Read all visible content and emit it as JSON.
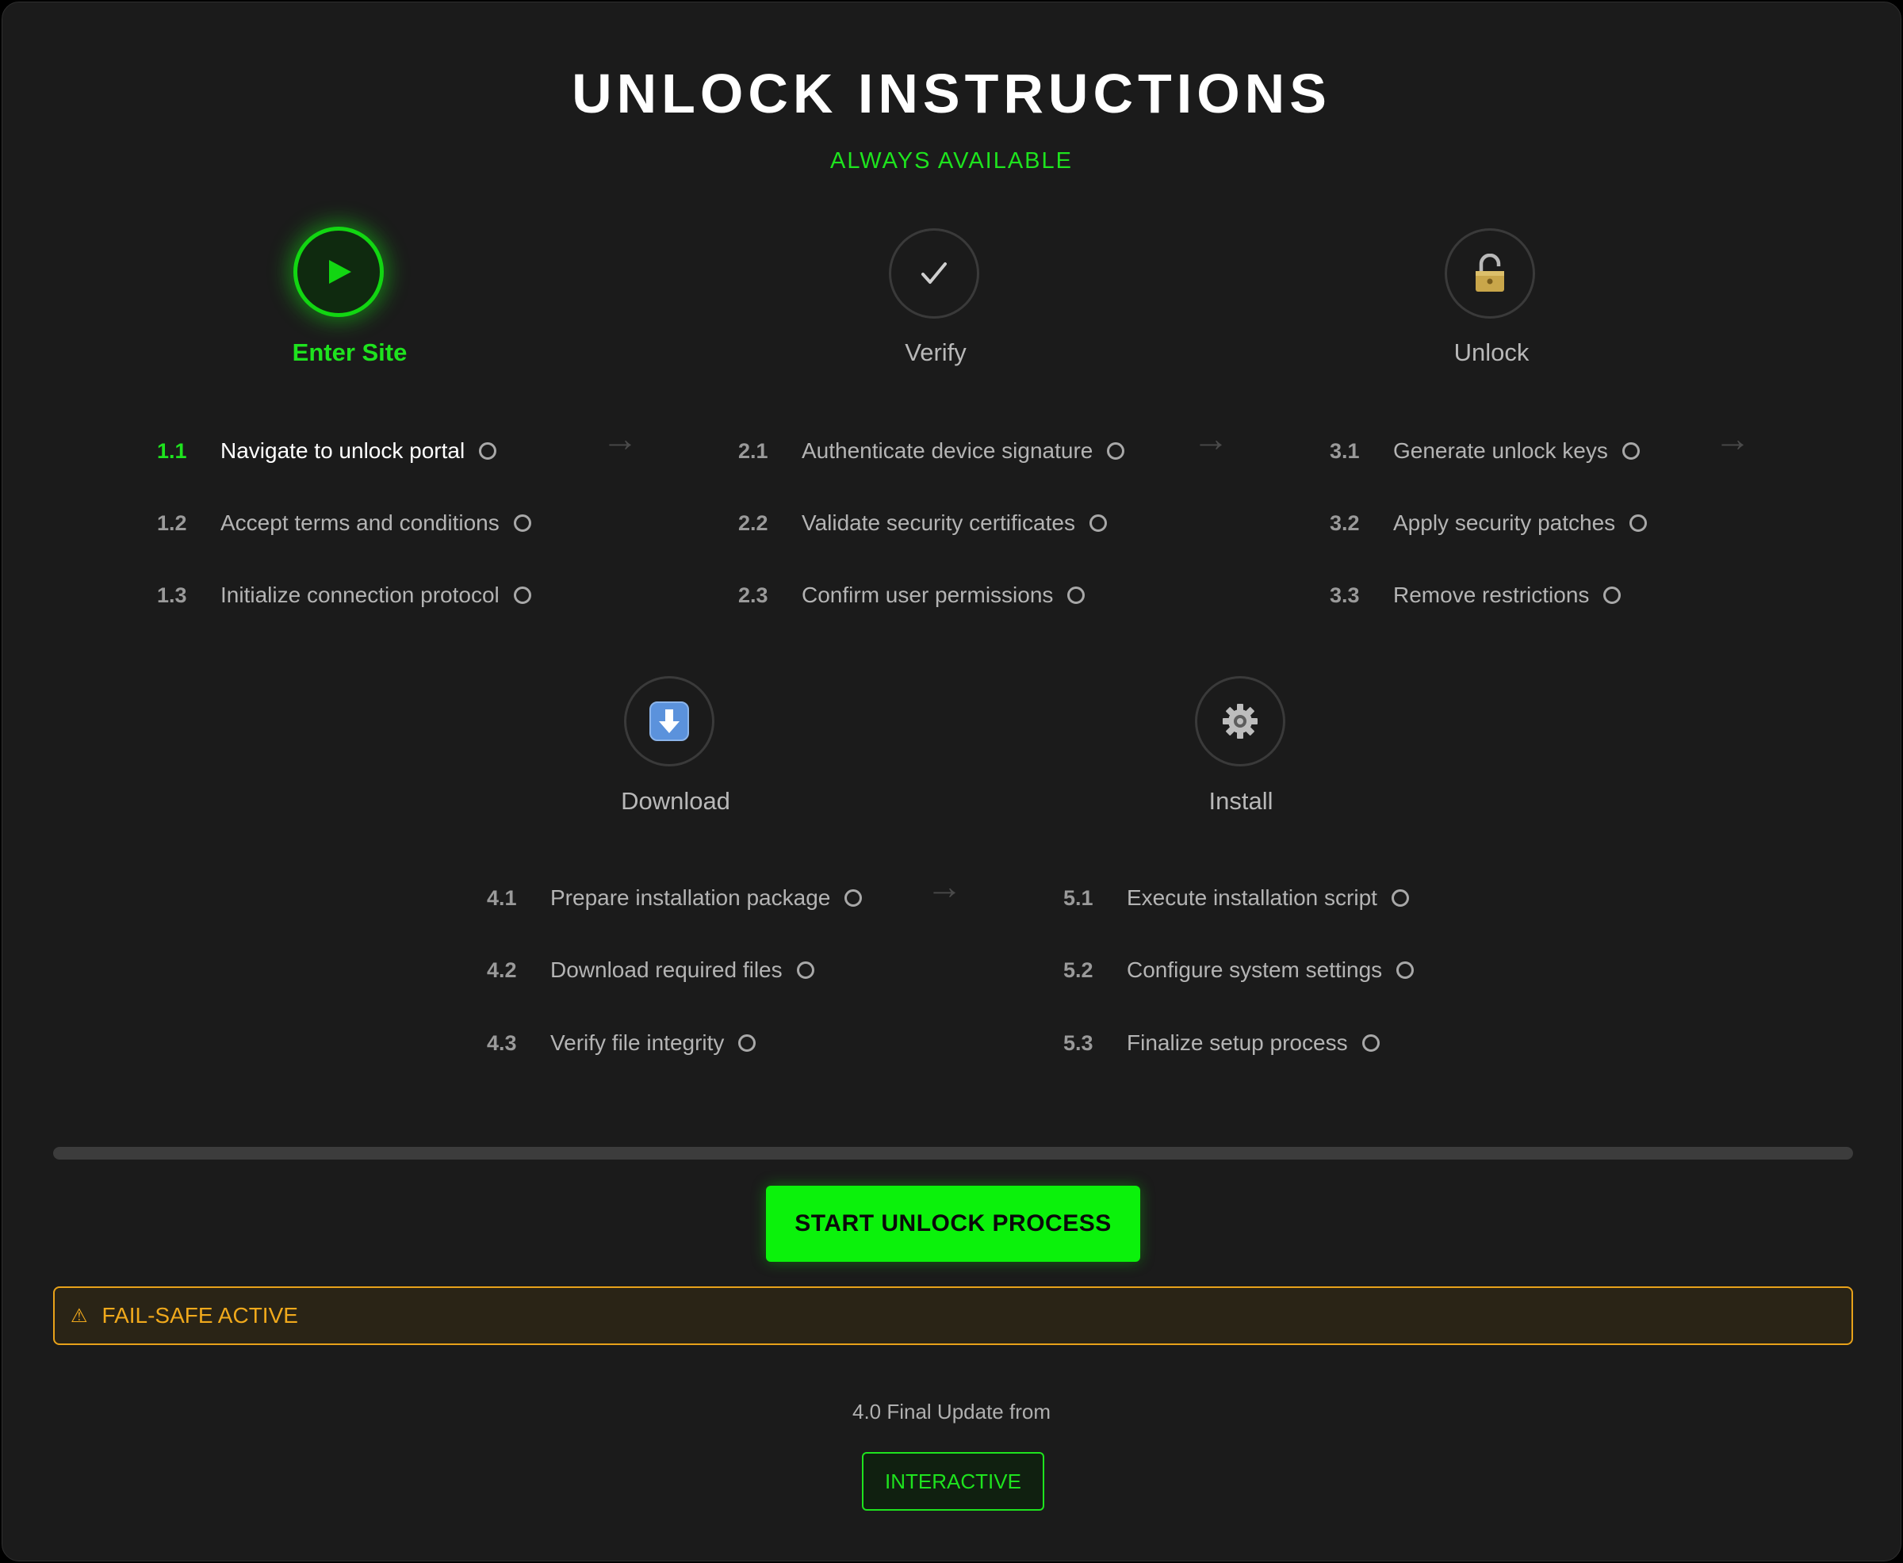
{
  "header": {
    "title": "UNLOCK INSTRUCTIONS",
    "subtitle": "ALWAYS AVAILABLE"
  },
  "stages": [
    {
      "label": "Enter Site",
      "icon": "play-icon",
      "active": true,
      "steps": [
        {
          "num": "1.1",
          "text": "Navigate to unlock portal"
        },
        {
          "num": "1.2",
          "text": "Accept terms and conditions"
        },
        {
          "num": "1.3",
          "text": "Initialize connection protocol"
        }
      ]
    },
    {
      "label": "Verify",
      "icon": "check-icon",
      "active": false,
      "steps": [
        {
          "num": "2.1",
          "text": "Authenticate device signature"
        },
        {
          "num": "2.2",
          "text": "Validate security certificates"
        },
        {
          "num": "2.3",
          "text": "Confirm user permissions"
        }
      ]
    },
    {
      "label": "Unlock",
      "icon": "padlock-icon",
      "active": false,
      "steps": [
        {
          "num": "3.1",
          "text": "Generate unlock keys"
        },
        {
          "num": "3.2",
          "text": "Apply security patches"
        },
        {
          "num": "3.3",
          "text": "Remove restrictions"
        }
      ]
    },
    {
      "label": "Download",
      "icon": "download-icon",
      "active": false,
      "steps": [
        {
          "num": "4.1",
          "text": "Prepare installation package"
        },
        {
          "num": "4.2",
          "text": "Download required files"
        },
        {
          "num": "4.3",
          "text": "Verify file integrity"
        }
      ]
    },
    {
      "label": "Install",
      "icon": "gear-icon",
      "active": false,
      "steps": [
        {
          "num": "5.1",
          "text": "Execute installation script"
        },
        {
          "num": "5.2",
          "text": "Configure system settings"
        },
        {
          "num": "5.3",
          "text": "Finalize setup process"
        }
      ]
    }
  ],
  "progress": {
    "percent": 0
  },
  "actions": {
    "start_label": "START UNLOCK PROCESS"
  },
  "alert": {
    "icon": "warning-icon",
    "text": "FAIL-SAFE ACTIVE"
  },
  "footer": {
    "text": "4.0 Final Update from",
    "button_label": "INTERACTIVE"
  },
  "colors": {
    "background": "#1b1b1b",
    "accent_green": "#0bf20b",
    "warning_orange": "#f0a91c"
  }
}
